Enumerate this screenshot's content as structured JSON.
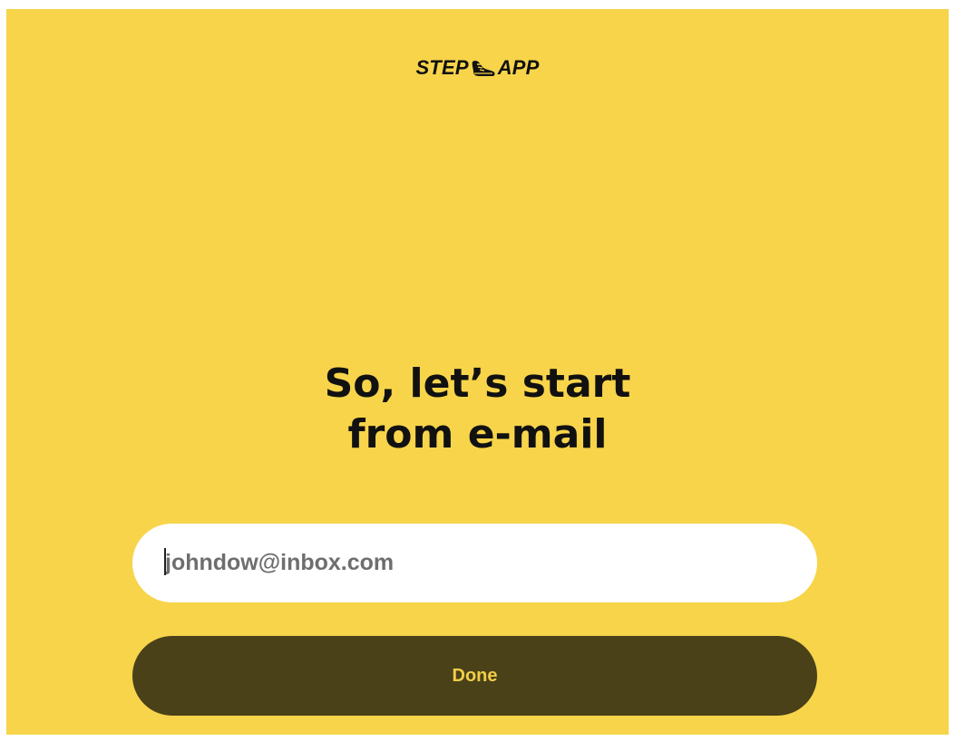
{
  "brand": {
    "left_text": "STEP",
    "right_text": "APP",
    "icon": "sneaker-icon"
  },
  "onboarding": {
    "heading_line1": "So, let’s start",
    "heading_line2": "from e-mail",
    "email_placeholder": "johndow@inbox.com",
    "email_value": "",
    "done_label": "Done"
  },
  "colors": {
    "background": "#f7d44a",
    "button_bg": "#4a4119",
    "button_text": "#f2cd48",
    "input_bg": "#ffffff"
  }
}
